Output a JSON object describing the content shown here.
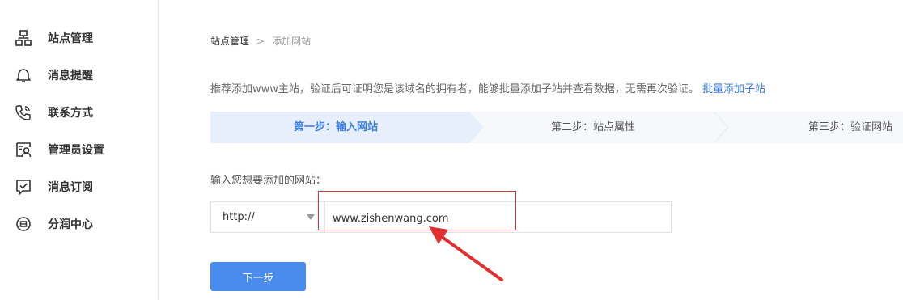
{
  "sidebar": {
    "items": [
      {
        "label": "站点管理",
        "icon": "sitemap-icon"
      },
      {
        "label": "消息提醒",
        "icon": "bell-icon"
      },
      {
        "label": "联系方式",
        "icon": "phone-icon"
      },
      {
        "label": "管理员设置",
        "icon": "admin-user-icon"
      },
      {
        "label": "消息订阅",
        "icon": "subscribe-check-icon"
      },
      {
        "label": "分润中心",
        "icon": "revenue-icon"
      }
    ]
  },
  "breadcrumb": {
    "parent": "站点管理",
    "separator": ">",
    "current": "添加网站"
  },
  "intro": {
    "text": "推荐添加www主站，验证后可证明您是该域名的拥有者，能够批量添加子站并查看数据，无需再次验证。",
    "link": "批量添加子站"
  },
  "steps": [
    {
      "label": "第一步：输入网站",
      "active": true
    },
    {
      "label": "第二步：站点属性",
      "active": false
    },
    {
      "label": "第三步：验证网站",
      "active": false
    }
  ],
  "form": {
    "label": "输入您想要添加的网站：",
    "protocol": "http://",
    "url_value": "www.zishenwang.com"
  },
  "next_button": "下一步",
  "colors": {
    "accent": "#4a8bee",
    "link": "#3b7de6",
    "highlight": "#e03030"
  }
}
